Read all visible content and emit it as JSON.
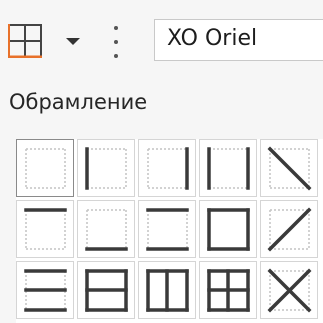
{
  "toolbar": {
    "borders_icon": "borders-icon",
    "dropdown_icon": "chevron-down-icon",
    "separator_icon": "vertical-dots-icon",
    "font_name": "XO Oriel",
    "accent_color": "#e8712a"
  },
  "panel": {
    "title": "Обрамление",
    "presets": [
      {
        "icon": "no-borders-icon"
      },
      {
        "icon": "left-border-icon"
      },
      {
        "icon": "right-border-icon"
      },
      {
        "icon": "left-and-right-borders-icon"
      },
      {
        "icon": "diagonal-down-border-icon"
      },
      {
        "icon": "top-border-icon"
      },
      {
        "icon": "bottom-border-icon"
      },
      {
        "icon": "top-and-bottom-borders-icon"
      },
      {
        "icon": "outer-border-icon"
      },
      {
        "icon": "diagonal-up-border-icon"
      },
      {
        "icon": "horizontal-borders-icon"
      },
      {
        "icon": "outer-and-horizontal-borders-icon"
      },
      {
        "icon": "outer-and-vertical-borders-icon"
      },
      {
        "icon": "all-borders-icon"
      },
      {
        "icon": "crossed-diagonal-borders-icon"
      }
    ]
  }
}
